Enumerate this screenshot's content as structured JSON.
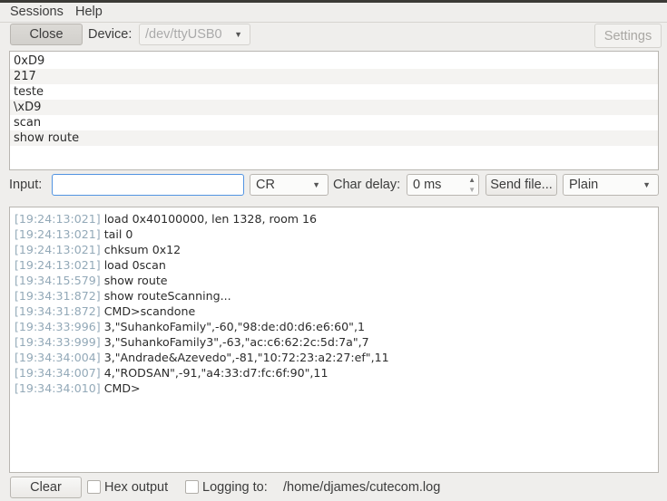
{
  "menu": {
    "items": [
      "Sessions",
      "Help"
    ]
  },
  "toolbar": {
    "close_label": "Close",
    "device_label": "Device:",
    "device_value": "/dev/ttyUSB0",
    "settings_label": "Settings"
  },
  "history": [
    "0xD9",
    "217",
    "teste",
    "\\xD9",
    "scan",
    "show route"
  ],
  "input_row": {
    "input_label": "Input:",
    "input_value": "",
    "line_end": "CR",
    "char_delay_label": "Char delay:",
    "char_delay_value": "0 ms",
    "send_file_label": "Send file...",
    "format": "Plain"
  },
  "output": [
    {
      "ts": "[19:24:13:021]",
      "text": "load 0x40100000, len 1328, room 16"
    },
    {
      "ts": "[19:24:13:021]",
      "text": "tail 0"
    },
    {
      "ts": "[19:24:13:021]",
      "text": "chksum 0x12"
    },
    {
      "ts": "[19:24:13:021]",
      "text": "load 0scan"
    },
    {
      "ts": "[19:34:15:579]",
      "text": "show route"
    },
    {
      "ts": "[19:34:31:872]",
      "text": "show routeScanning..."
    },
    {
      "ts": "[19:34:31:872]",
      "text": "CMD>scandone"
    },
    {
      "ts": "[19:34:33:996]",
      "text": "3,\"SuhankoFamily\",-60,\"98:de:d0:d6:e6:60\",1"
    },
    {
      "ts": "[19:34:33:999]",
      "text": "3,\"SuhankoFamily3\",-63,\"ac:c6:62:2c:5d:7a\",7"
    },
    {
      "ts": "[19:34:34:004]",
      "text": "3,\"Andrade&Azevedo\",-81,\"10:72:23:a2:27:ef\",11"
    },
    {
      "ts": "[19:34:34:007]",
      "text": "4,\"RODSAN\",-91,\"a4:33:d7:fc:6f:90\",11"
    },
    {
      "ts": "[19:34:34:010]",
      "text": "CMD>"
    }
  ],
  "bottom": {
    "clear_label": "Clear",
    "hex_output_label": "Hex output",
    "hex_output_checked": false,
    "logging_label": "Logging to:",
    "logging_checked": false,
    "log_path": "/home/djames/cutecom.log"
  },
  "colors": {
    "timestamp": "#93a9b8",
    "background": "#efeeec",
    "input_focus": "#5294e2"
  }
}
